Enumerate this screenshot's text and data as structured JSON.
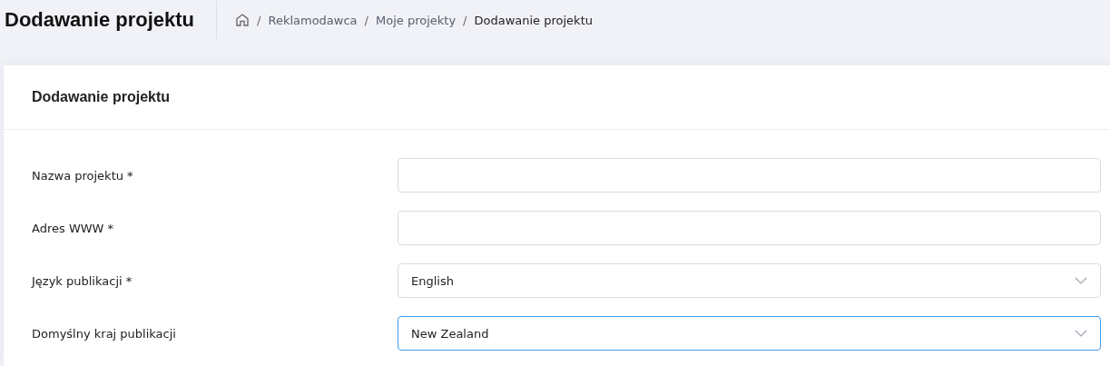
{
  "page_title": "Dodawanie projektu",
  "breadcrumb": [
    {
      "label": "Reklamodawca",
      "current": false
    },
    {
      "label": "Moje projekty",
      "current": false
    },
    {
      "label": "Dodawanie projektu",
      "current": true
    }
  ],
  "breadcrumb_separator": "/",
  "card": {
    "title": "Dodawanie projektu",
    "fields": [
      {
        "label": "Nazwa projektu *",
        "kind": "text",
        "focused": false
      },
      {
        "label": "Adres WWW *",
        "kind": "text",
        "focused": false
      },
      {
        "label": "Język publikacji *",
        "kind": "select",
        "value": "English",
        "focused": false
      },
      {
        "label": "Domyślny kraj publikacji",
        "kind": "select",
        "value": "New Zealand",
        "focused": true
      }
    ]
  }
}
